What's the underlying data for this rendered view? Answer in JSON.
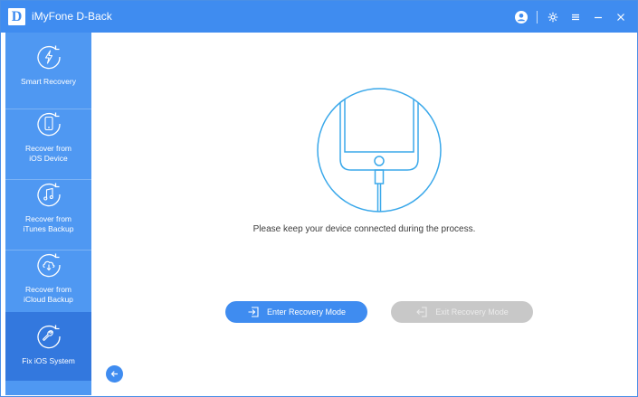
{
  "app": {
    "logo_letter": "D",
    "title": "iMyFone D-Back",
    "icons": [
      "account-icon",
      "settings-icon",
      "menu-icon",
      "minimize-icon",
      "close-icon"
    ]
  },
  "sidebar": {
    "items": [
      {
        "label": "Smart Recovery",
        "icon": "lightning-recover-icon",
        "active": false
      },
      {
        "label": "Recover from\niOS Device",
        "icon": "phone-recover-icon",
        "active": false
      },
      {
        "label": "Recover from\niTunes Backup",
        "icon": "music-recover-icon",
        "active": false
      },
      {
        "label": "Recover from\niCloud Backup",
        "icon": "cloud-recover-icon",
        "active": false
      },
      {
        "label": "Fix iOS System",
        "icon": "wrench-icon",
        "active": true
      }
    ]
  },
  "main": {
    "message": "Please keep your device connected during the process.",
    "enter_label": "Enter Recovery Mode",
    "exit_label": "Exit Recovery Mode"
  },
  "colors": {
    "accent": "#3f8cf0",
    "sidebar": "#4f98f2",
    "sidebar_active": "#3378de",
    "disabled": "#c8c8c8"
  }
}
